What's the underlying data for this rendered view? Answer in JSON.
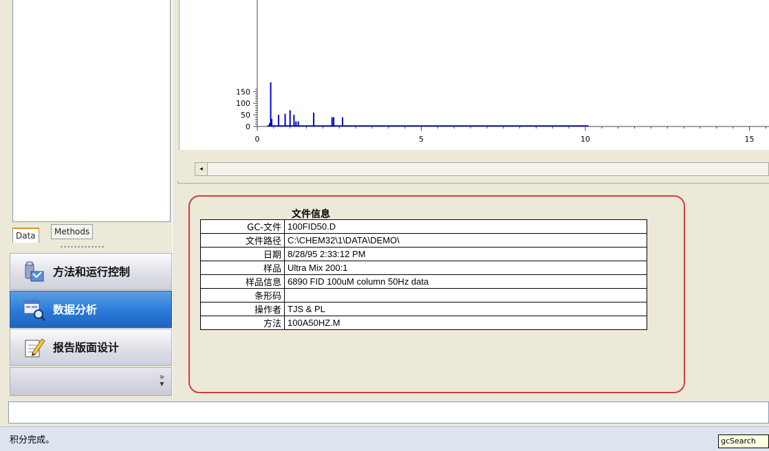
{
  "left_nav": {
    "tabs": [
      {
        "label": "Data",
        "active": true
      },
      {
        "label": "Methods",
        "active": false
      }
    ],
    "buttons": [
      {
        "label": "方法和运行控制",
        "icon": "instrument-icon",
        "active": false
      },
      {
        "label": "数据分析",
        "icon": "chart-magnifier-icon",
        "active": true
      },
      {
        "label": "报告版面设计",
        "icon": "pencil-report-icon",
        "active": false
      }
    ],
    "more_icon": "double-chevron-down-icon"
  },
  "chart_data": {
    "type": "line",
    "title": "",
    "xlabel": "",
    "ylabel": "",
    "xlim": [
      0,
      15.3
    ],
    "ylim": [
      0,
      160
    ],
    "x_ticks": [
      "0",
      "5",
      "10",
      "15"
    ],
    "y_ticks": [
      "0",
      "50",
      "100",
      "150"
    ],
    "series": [
      {
        "color": "#0000cc",
        "peaks": [
          {
            "x": 0.38,
            "y": 15
          },
          {
            "x": 0.41,
            "y": 190
          },
          {
            "x": 0.44,
            "y": 33
          },
          {
            "x": 0.65,
            "y": 50
          },
          {
            "x": 0.85,
            "y": 55
          },
          {
            "x": 1.0,
            "y": 70
          },
          {
            "x": 1.12,
            "y": 50
          },
          {
            "x": 1.18,
            "y": 22
          },
          {
            "x": 1.25,
            "y": 22
          },
          {
            "x": 1.72,
            "y": 60
          },
          {
            "x": 2.28,
            "y": 40
          },
          {
            "x": 2.33,
            "y": 40
          },
          {
            "x": 2.6,
            "y": 40
          }
        ],
        "baseline_end_x": 10.1
      }
    ]
  },
  "file_info": {
    "title": "文件信息",
    "rows": [
      {
        "key": "GC-文件",
        "value": "100FID50.D"
      },
      {
        "key": "文件路径",
        "value": "C:\\CHEM32\\1\\DATA\\DEMO\\"
      },
      {
        "key": "日期",
        "value": "8/28/95 2:33:12 PM"
      },
      {
        "key": "样品",
        "value": "Ultra Mix 200:1"
      },
      {
        "key": "样品信息",
        "value": "6890 FID 100uM column 50Hz data"
      },
      {
        "key": "条形码",
        "value": ""
      },
      {
        "key": "操作者",
        "value": "TJS & PL"
      },
      {
        "key": "方法",
        "value": "100A50HZ.M"
      }
    ]
  },
  "status_bar": {
    "text": "积分完成。",
    "tooltip": "gcSearch"
  },
  "scrollbar": {
    "left_arrow": "◂"
  }
}
